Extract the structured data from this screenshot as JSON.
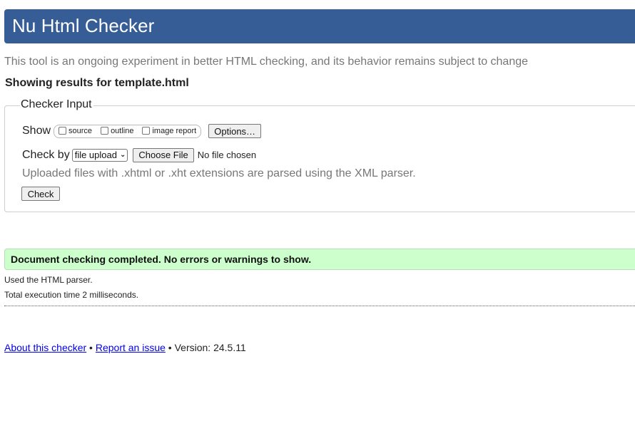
{
  "header": {
    "title": "Nu Html Checker",
    "background_color": "#365d95"
  },
  "intro_text": "This tool is an ongoing experiment in better HTML checking, and its behavior remains subject to change",
  "showing_text": "Showing results for template.html",
  "checker_input": {
    "legend": "Checker Input",
    "show_label": "Show",
    "show_options": [
      {
        "label": "source",
        "checked": false
      },
      {
        "label": "outline",
        "checked": false
      },
      {
        "label": "image report",
        "checked": false
      }
    ],
    "options_button": "Options…",
    "check_by_label": "Check by",
    "check_by_selected": "file upload",
    "choose_file_button": "Choose File",
    "no_file_text": "No file chosen",
    "uploaded_note": "Uploaded files with .xhtml or .xht extensions are parsed using the XML parser.",
    "check_button": "Check"
  },
  "result": {
    "message": "Document checking completed. No errors or warnings to show.",
    "background_color": "#ccffcc"
  },
  "parser_note": "Used the HTML parser.",
  "exec_note": "Total execution time 2 milliseconds.",
  "footer": {
    "about_link": "About this checker",
    "separator1": " • ",
    "report_link": "Report an issue",
    "version_text": " • Version: 24.5.11"
  }
}
